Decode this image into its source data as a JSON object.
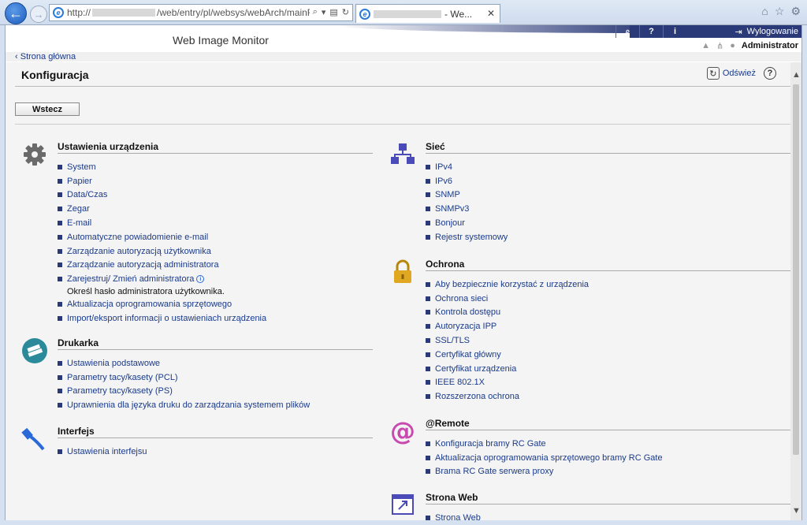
{
  "browser": {
    "url_prefix": "http://",
    "url_suffix": "/web/entry/pl/websys/webArch/mainFrar",
    "tab_title": "- We...",
    "close_tab_label": "✕"
  },
  "header": {
    "app_title": "Web Image Monitor",
    "logout_label": "Wylogowanie",
    "user_name": "Administrator",
    "top_icons": [
      "search-icon",
      "help-icon",
      "info-icon"
    ]
  },
  "breadcrumb": "Strona główna",
  "page": {
    "title": "Konfiguracja",
    "refresh_label": "Odśwież",
    "back_button": "Wstecz"
  },
  "sections": {
    "device": {
      "title": "Ustawienia urządzenia",
      "links": [
        "System",
        "Papier",
        "Data/Czas",
        "Zegar",
        "E-mail",
        "Automatyczne powiadomienie e-mail",
        "Zarządzanie autoryzacją użytkownika",
        "Zarządzanie autoryzacją administratora",
        "Zarejestruj/ Zmień administratora",
        "Aktualizacja oprogramowania sprzętowego",
        "Import/eksport informacji o ustawieniach urządzenia"
      ],
      "note": "Określ hasło administratora użytkownika."
    },
    "printer": {
      "title": "Drukarka",
      "links": [
        "Ustawienia podstawowe",
        "Parametry tacy/kasety (PCL)",
        "Parametry tacy/kasety (PS)",
        "Uprawnienia dla języka druku do zarządzania systemem plików"
      ]
    },
    "interface": {
      "title": "Interfejs",
      "links": [
        "Ustawienia interfejsu"
      ]
    },
    "network": {
      "title": "Sieć",
      "links": [
        "IPv4",
        "IPv6",
        "SNMP",
        "SNMPv3",
        "Bonjour",
        "Rejestr systemowy"
      ]
    },
    "security": {
      "title": "Ochrona",
      "links": [
        "Aby bezpiecznie korzystać z urządzenia",
        "Ochrona sieci",
        "Kontrola dostępu",
        "Autoryzacja IPP",
        "SSL/TLS",
        "Certyfikat główny",
        "Certyfikat urządzenia",
        "IEEE 802.1X",
        "Rozszerzona ochrona"
      ]
    },
    "remote": {
      "title": "@Remote",
      "links": [
        "Konfiguracja bramy RC Gate",
        "Aktualizacja oprogramowania sprzętowego bramy RC Gate",
        "Brama RC Gate serwera proxy"
      ]
    },
    "web": {
      "title": "Strona Web",
      "links": [
        "Strona Web"
      ]
    }
  },
  "colors": {
    "brand_band": "#2a3a78",
    "link": "#1a3a8a"
  }
}
